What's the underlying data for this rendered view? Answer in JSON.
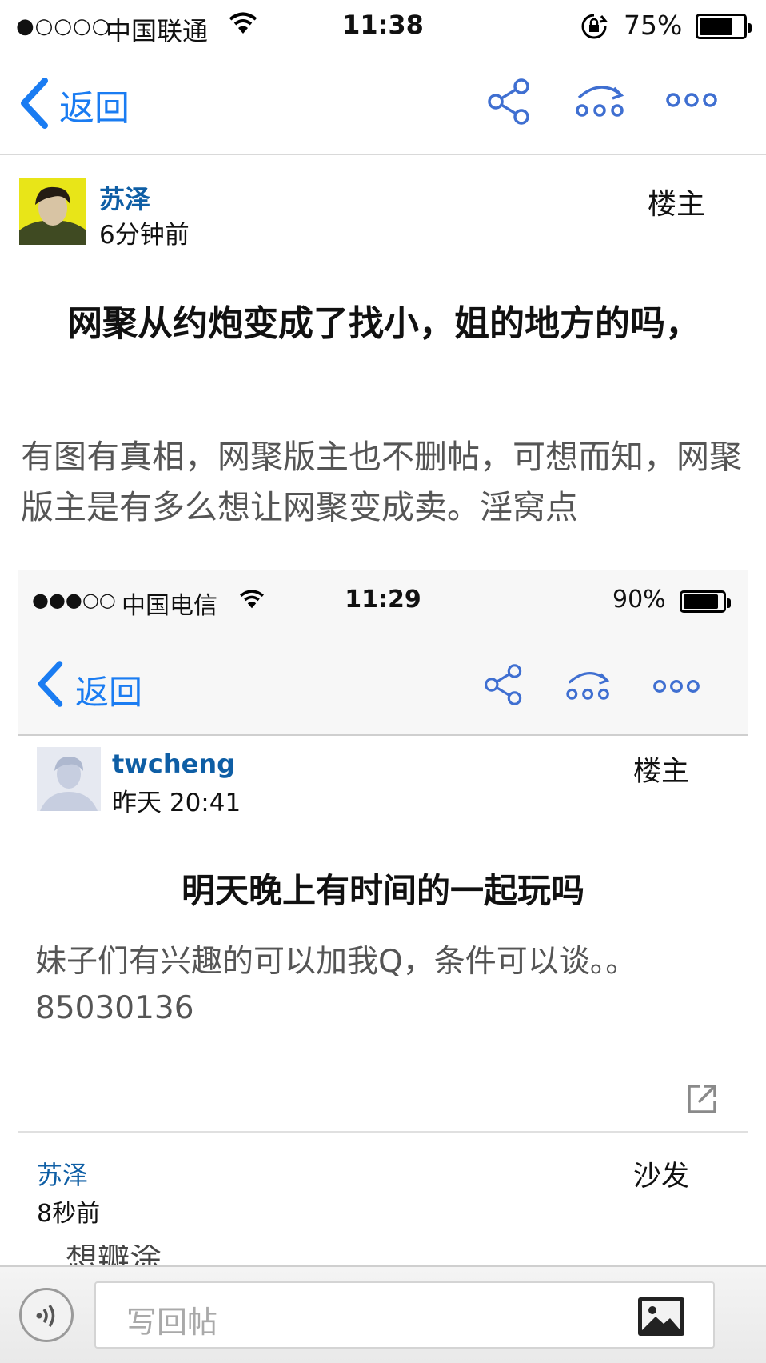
{
  "status_bar": {
    "signal": "●○○○○",
    "carrier": "中国联通",
    "time": "11:38",
    "battery_pct": "75%",
    "battery_level": 0.75
  },
  "nav": {
    "back_label": "返回"
  },
  "post": {
    "author": "苏泽",
    "time_ago": "6分钟前",
    "floor": "楼主",
    "title": "网聚从约炮变成了找小，姐的地方的吗，",
    "body": "有图有真相，网聚版主也不删帖，可想而知，网聚版主是有多么想让网聚变成卖。淫窝点"
  },
  "embedded": {
    "status_bar": {
      "signal": "●●●○○",
      "carrier": "中国电信",
      "time": "11:29",
      "battery_pct": "90%",
      "battery_level": 0.9
    },
    "nav": {
      "back_label": "返回"
    },
    "post": {
      "author": "twcheng",
      "time": "昨天 20:41",
      "floor": "楼主",
      "title": "明天晚上有时间的一起玩吗",
      "body": "妹子们有兴趣的可以加我Q，条件可以谈。。85030136"
    },
    "reply": {
      "author": "苏泽",
      "time": "8秒前",
      "floor": "沙发",
      "partial_text": "想瓣涂"
    }
  },
  "toolbar": {
    "reply_placeholder": "写回帖"
  },
  "colors": {
    "ios_blue": "#1a7cf2",
    "author_blue": "#0e5ea5",
    "icon_blue": "#3f6fd1"
  }
}
